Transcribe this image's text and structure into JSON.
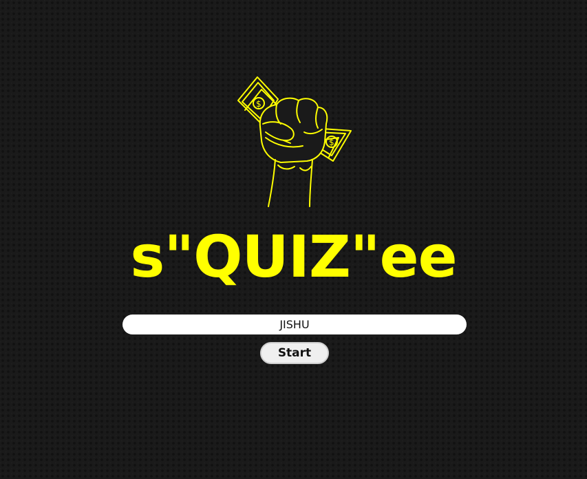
{
  "logo": {
    "icon": "fist-with-money-icon",
    "color": "#ffff00"
  },
  "title": "s\"QUIZ\"ee",
  "name_input": {
    "value": "JISHU"
  },
  "start_button": {
    "label": "Start"
  },
  "colors": {
    "background": "#1a1a1a",
    "accent": "#ffff00",
    "input_background": "#ffffff",
    "button_background": "#efefef"
  }
}
